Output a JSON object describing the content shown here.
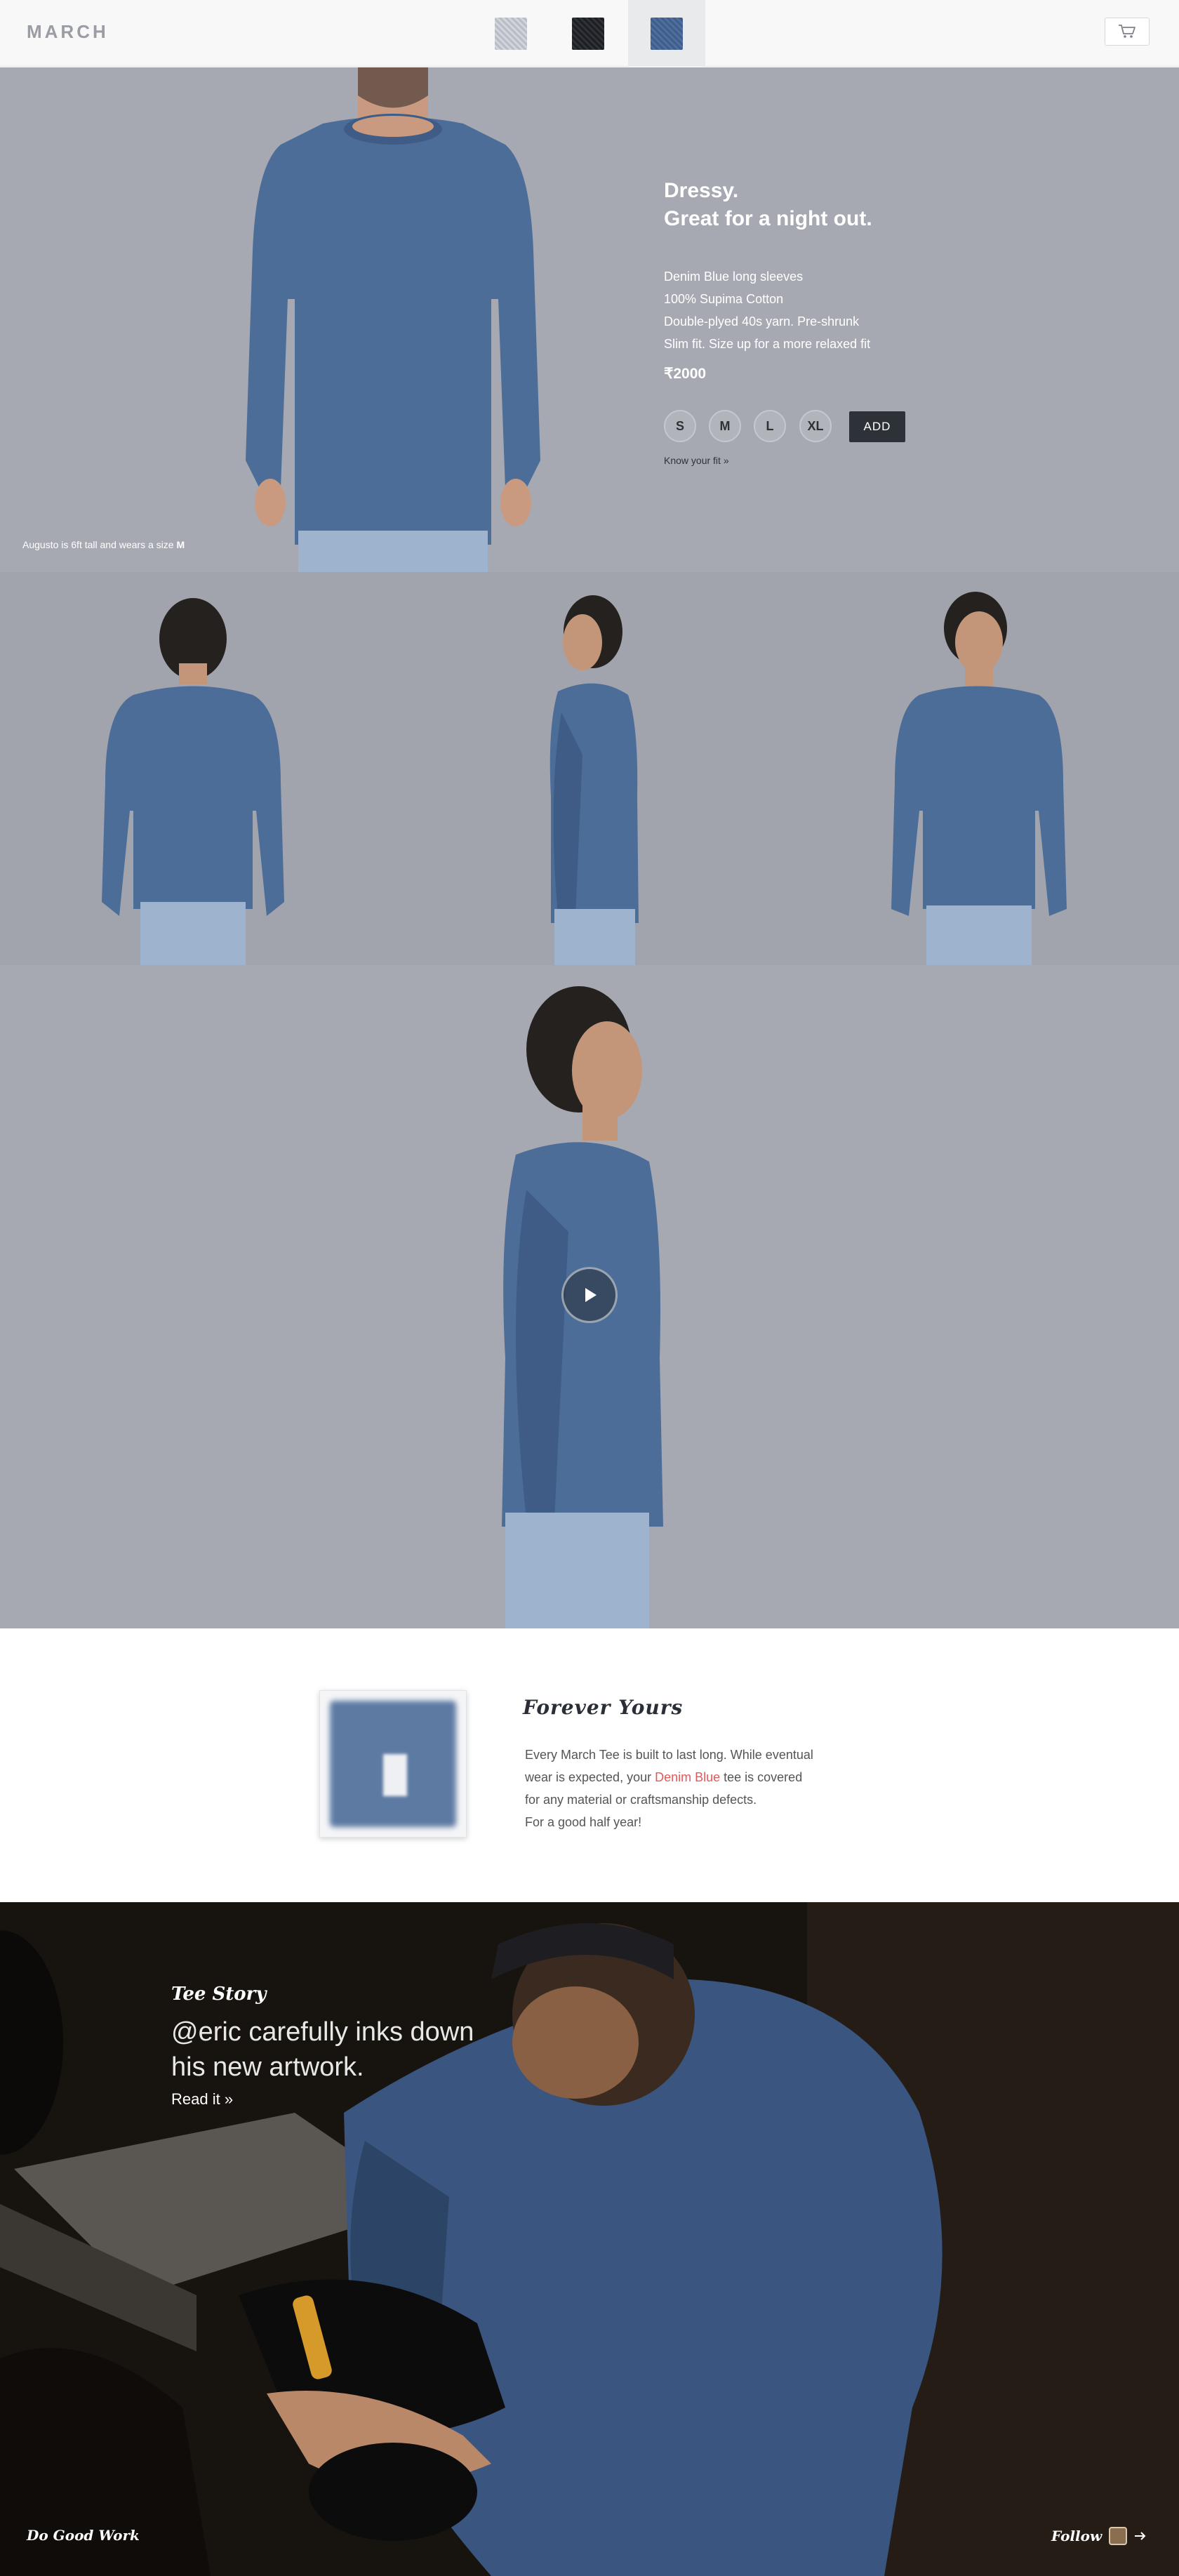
{
  "header": {
    "logo": "MARCH",
    "swatches": [
      {
        "name": "grey",
        "color": "#c4c7cf"
      },
      {
        "name": "black",
        "color": "#24262b"
      },
      {
        "name": "blue",
        "color": "#4a6896",
        "active": true
      }
    ],
    "cart_icon": "cart-icon"
  },
  "hero": {
    "title_line1": "Dressy.",
    "title_line2": "Great for a night out.",
    "features": [
      "Denim Blue long sleeves",
      "100% Supima Cotton",
      "Double-plyed 40s yarn. Pre-shrunk",
      "Slim fit. Size up for a more relaxed fit"
    ],
    "price": "₹2000",
    "sizes": [
      "S",
      "M",
      "L",
      "XL"
    ],
    "add_label": "ADD",
    "fit_link": "Know your fit »",
    "caption_text": "Augusto is 6ft tall and wears a size",
    "caption_size": "M",
    "background": "#a7a9b2",
    "shirt_color": "#4d6d99"
  },
  "video": {
    "play_icon": "play-icon"
  },
  "forever": {
    "title": "Forever Yours",
    "line1_a": "Every March Tee is built to last long. While eventual",
    "line2_a": "wear is expected, your ",
    "line2_highlight": "Denim Blue",
    "line2_b": " tee is covered",
    "line3": "for any material or craftsmanship defects.",
    "line4": "For a good half year!",
    "highlight_color": "#e0595b"
  },
  "story": {
    "label": "Tee Story",
    "title": "@eric carefully inks down his new artwork.",
    "link": "Read it »",
    "footer_left": "Do Good Work",
    "footer_right": "Follow",
    "follow_icon": "instagram-icon",
    "follow_arrow": "arrow-right-icon"
  }
}
